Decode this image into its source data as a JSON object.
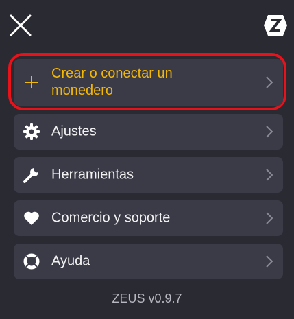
{
  "header": {
    "close_icon": "close-icon",
    "logo_icon": "zeus-logo-icon"
  },
  "menu": {
    "items": [
      {
        "label": "Crear o conectar un monedero",
        "icon": "plus-icon",
        "accent": "#f3b705",
        "highlighted": true
      },
      {
        "label": "Ajustes",
        "icon": "gear-icon"
      },
      {
        "label": "Herramientas",
        "icon": "wrench-icon"
      },
      {
        "label": "Comercio y soporte",
        "icon": "heart-icon"
      },
      {
        "label": "Ayuda",
        "icon": "lifebuoy-icon"
      }
    ]
  },
  "footer": {
    "version": "ZEUS v0.9.7"
  },
  "colors": {
    "background": "#2a2a33",
    "card": "#3b3b47",
    "accent": "#f3b705",
    "highlight_border": "#e8121b"
  }
}
